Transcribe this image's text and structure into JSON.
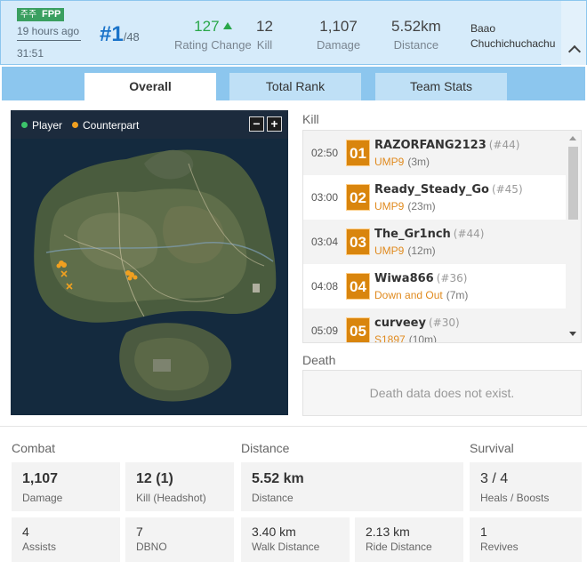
{
  "match": {
    "mode_icon": "주주",
    "mode": "FPP",
    "ago": "19 hours ago",
    "duration": "31:51",
    "rank_prefix": "#",
    "rank": "1",
    "total": "/48",
    "team": [
      "Baao",
      "Chuchichuchachu"
    ]
  },
  "header_stats": [
    {
      "value": "127",
      "label": "Rating Change"
    },
    {
      "value": "12",
      "label": "Kill"
    },
    {
      "value": "1,107",
      "label": "Damage"
    },
    {
      "value": "5.52km",
      "label": "Distance"
    }
  ],
  "tabs": [
    "Overall",
    "Total Rank",
    "Team Stats"
  ],
  "map": {
    "legend_player": "Player",
    "legend_counterpart": "Counterpart",
    "zoom_out": "−",
    "zoom_in": "+",
    "player_color": "#3cc36a",
    "counterpart_color": "#f0a020"
  },
  "kill_title": "Kill",
  "kills": [
    {
      "time": "02:50",
      "num": "01",
      "name": "RAZORFANG2123",
      "rank": "(#44)",
      "weapon": "UMP9",
      "dist": "(3m)"
    },
    {
      "time": "03:00",
      "num": "02",
      "name": "Ready_Steady_Go",
      "rank": "(#45)",
      "weapon": "UMP9",
      "dist": "(23m)"
    },
    {
      "time": "03:04",
      "num": "03",
      "name": "The_Gr1nch",
      "rank": "(#44)",
      "weapon": "UMP9",
      "dist": "(12m)"
    },
    {
      "time": "04:08",
      "num": "04",
      "name": "Wiwa866",
      "rank": "(#36)",
      "weapon": "Down and Out",
      "dist": "(7m)"
    },
    {
      "time": "05:09",
      "num": "05",
      "name": "curveey",
      "rank": "(#30)",
      "weapon": "S1897",
      "dist": "(10m)"
    }
  ],
  "death_title": "Death",
  "death_empty": "Death data does not exist.",
  "stats": {
    "combat_title": "Combat",
    "distance_title": "Distance",
    "survival_title": "Survival",
    "damage": {
      "value": "1,107",
      "label": "Damage"
    },
    "kill": {
      "value": "12 (1)",
      "label": "Kill (Headshot)"
    },
    "distance": {
      "value": "5.52 km",
      "label": "Distance"
    },
    "heals": {
      "value": "3 / 4",
      "label": "Heals / Boosts"
    },
    "assists": {
      "value": "4",
      "label": "Assists"
    },
    "dbno": {
      "value": "7",
      "label": "DBNO"
    },
    "walk": {
      "value": "3.40 km",
      "label": "Walk Distance"
    },
    "ride": {
      "value": "2.13 km",
      "label": "Ride Distance"
    },
    "revives": {
      "value": "1",
      "label": "Revives"
    }
  }
}
